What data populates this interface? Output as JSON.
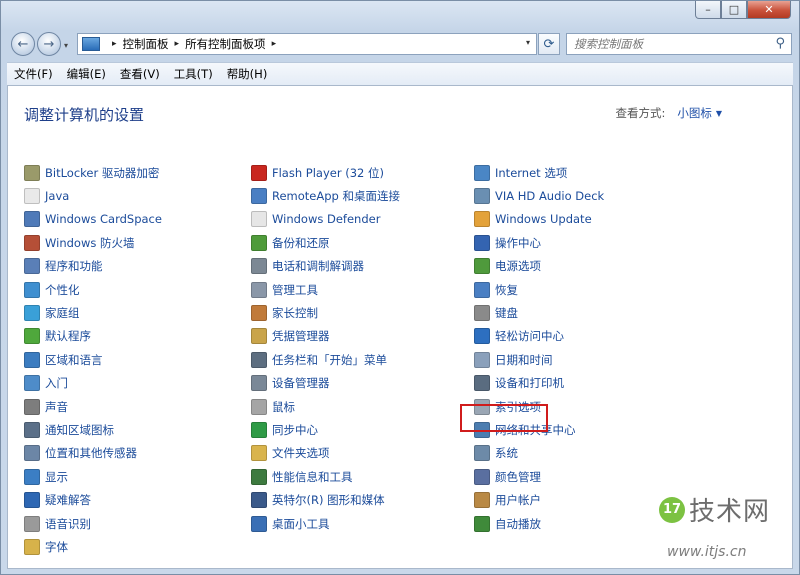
{
  "titlebar": {
    "min_label": "–",
    "max_label": "□",
    "close_label": "✕"
  },
  "nav": {
    "back_icon": "←",
    "forward_icon": "→",
    "recent_icon": "▾"
  },
  "address": {
    "icon": "control-panel-icon",
    "crumbs": [
      "控制面板",
      "所有控制面板项"
    ],
    "sep": "▸",
    "dropdown": "▾"
  },
  "refresh_icon": "⟳",
  "search": {
    "placeholder": "搜索控制面板",
    "icon": "⚲"
  },
  "menu": [
    "文件(F)",
    "编辑(E)",
    "查看(V)",
    "工具(T)",
    "帮助(H)"
  ],
  "heading": "调整计算机的设置",
  "view_by": {
    "label": "查看方式:",
    "value": "小图标",
    "arrow": "▼"
  },
  "items": {
    "col1": [
      {
        "label": "BitLocker 驱动器加密",
        "color": "#9a9a6a"
      },
      {
        "label": "Java",
        "color": "#e9e9e9"
      },
      {
        "label": "Windows CardSpace",
        "color": "#4f7ab8"
      },
      {
        "label": "Windows 防火墙",
        "color": "#b54f37"
      },
      {
        "label": "程序和功能",
        "color": "#5a7fb7"
      },
      {
        "label": "个性化",
        "color": "#3f8fd0"
      },
      {
        "label": "家庭组",
        "color": "#3aa0d8"
      },
      {
        "label": "默认程序",
        "color": "#4fa83c"
      },
      {
        "label": "区域和语言",
        "color": "#3b7cc0"
      },
      {
        "label": "入门",
        "color": "#4e8cc9"
      },
      {
        "label": "声音",
        "color": "#7d7d7d"
      },
      {
        "label": "通知区域图标",
        "color": "#5b6f88"
      },
      {
        "label": "位置和其他传感器",
        "color": "#6c86a6"
      },
      {
        "label": "显示",
        "color": "#3b7ec4"
      },
      {
        "label": "疑难解答",
        "color": "#2d67b3"
      },
      {
        "label": "语音识别",
        "color": "#9a9a9a"
      },
      {
        "label": "字体",
        "color": "#d7b24a"
      }
    ],
    "col2": [
      {
        "label": "Flash Player (32 位)",
        "color": "#c9271f"
      },
      {
        "label": "RemoteApp 和桌面连接",
        "color": "#4a7fc3"
      },
      {
        "label": "Windows Defender",
        "color": "#e6e6e6"
      },
      {
        "label": "备份和还原",
        "color": "#4f9b3a"
      },
      {
        "label": "电话和调制解调器",
        "color": "#7c8894"
      },
      {
        "label": "管理工具",
        "color": "#8a97a8"
      },
      {
        "label": "家长控制",
        "color": "#c07a3a"
      },
      {
        "label": "凭据管理器",
        "color": "#c9a44a"
      },
      {
        "label": "任务栏和「开始」菜单",
        "color": "#5d6e80"
      },
      {
        "label": "设备管理器",
        "color": "#7a8897"
      },
      {
        "label": "鼠标",
        "color": "#a5a5a5"
      },
      {
        "label": "同步中心",
        "color": "#2f9b46"
      },
      {
        "label": "文件夹选项",
        "color": "#d9b44c"
      },
      {
        "label": "性能信息和工具",
        "color": "#3d7a3f"
      },
      {
        "label": "英特尔(R) 图形和媒体",
        "color": "#3b5a8a"
      },
      {
        "label": "桌面小工具",
        "color": "#3a6fb5"
      }
    ],
    "col3": [
      {
        "label": "Internet 选项",
        "color": "#4a86c5"
      },
      {
        "label": "VIA HD Audio Deck",
        "color": "#6a8fb2"
      },
      {
        "label": "Windows Update",
        "color": "#e3a23a"
      },
      {
        "label": "操作中心",
        "color": "#3464b1"
      },
      {
        "label": "电源选项",
        "color": "#4f9a3c"
      },
      {
        "label": "恢复",
        "color": "#4a7fc3"
      },
      {
        "label": "键盘",
        "color": "#8a8a8a"
      },
      {
        "label": "轻松访问中心",
        "color": "#2d6fc0"
      },
      {
        "label": "日期和时间",
        "color": "#8aa0bb"
      },
      {
        "label": "设备和打印机",
        "color": "#5a6c80"
      },
      {
        "label": "索引选项",
        "color": "#9aa6b4"
      },
      {
        "label": "网络和共享中心",
        "color": "#4c7db0"
      },
      {
        "label": "系统",
        "color": "#6d8aa8"
      },
      {
        "label": "颜色管理",
        "color": "#5a6fa0"
      },
      {
        "label": "用户帐户",
        "color": "#b98945"
      },
      {
        "label": "自动播放",
        "color": "#3f8a3a"
      }
    ]
  },
  "watermark": {
    "logo": "17",
    "text": "技术网",
    "url": "www.itjs.cn"
  }
}
